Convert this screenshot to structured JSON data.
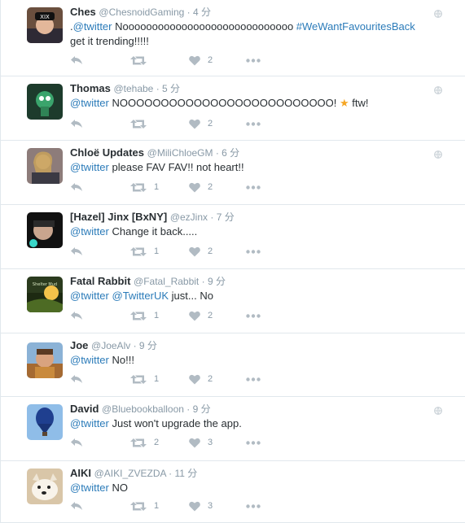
{
  "colors": {
    "link": "#2b7bb9",
    "meta": "#8899a6",
    "icon": "#b1bbc3",
    "divider": "#e1e8ed"
  },
  "tweets": [
    {
      "name": "Ches",
      "handle": "@ChesnoidGaming",
      "time": "4 分",
      "text": [
        {
          "t": "."
        },
        {
          "t": "@twitter",
          "k": "mention"
        },
        {
          "t": " Nooooooooooooooooooooooooooooo "
        },
        {
          "t": "#WeWantFavouritesBack",
          "k": "hashtag"
        },
        {
          "t": " get it trending!!!!!"
        }
      ],
      "retweets": "",
      "likes": "2",
      "globe": true
    },
    {
      "name": "Thomas",
      "handle": "@tehabe",
      "time": "5 分",
      "text": [
        {
          "t": "@twitter",
          "k": "mention"
        },
        {
          "t": " NOOOOOOOOOOOOOOOOOOOOOOOOOO! "
        },
        {
          "t": "★",
          "k": "star"
        },
        {
          "t": " ftw!"
        }
      ],
      "retweets": "",
      "likes": "2",
      "globe": true
    },
    {
      "name": "Chloë Updates",
      "handle": "@MiliChloeGM",
      "time": "6 分",
      "text": [
        {
          "t": "@twitter",
          "k": "mention"
        },
        {
          "t": " please FAV FAV!! not heart!!"
        }
      ],
      "retweets": "1",
      "likes": "2",
      "globe": true
    },
    {
      "name": "[Hazel] Jinx [BxNY]",
      "handle": "@ezJinx",
      "time": "7 分",
      "text": [
        {
          "t": "@twitter",
          "k": "mention"
        },
        {
          "t": " Change it back....."
        }
      ],
      "retweets": "1",
      "likes": "2",
      "globe": false
    },
    {
      "name": "Fatal Rabbit",
      "handle": "@Fatal_Rabbit",
      "time": "9 分",
      "text": [
        {
          "t": "@twitter",
          "k": "mention"
        },
        {
          "t": " "
        },
        {
          "t": "@TwitterUK",
          "k": "mention"
        },
        {
          "t": " just... No"
        }
      ],
      "retweets": "1",
      "likes": "2",
      "globe": false
    },
    {
      "name": "Joe",
      "handle": "@JoeAlv",
      "time": "9 分",
      "text": [
        {
          "t": "@twitter",
          "k": "mention"
        },
        {
          "t": " No!!!"
        }
      ],
      "retweets": "1",
      "likes": "2",
      "globe": false
    },
    {
      "name": "David",
      "handle": "@Bluebookballoon",
      "time": "9 分",
      "text": [
        {
          "t": "@twitter",
          "k": "mention"
        },
        {
          "t": " Just won't upgrade the app."
        }
      ],
      "retweets": "2",
      "likes": "3",
      "globe": true
    },
    {
      "name": "AIKI",
      "handle": "@AIKI_ZVEZDA",
      "time": "11 分",
      "text": [
        {
          "t": "@twitter",
          "k": "mention"
        },
        {
          "t": " NO"
        }
      ],
      "retweets": "1",
      "likes": "3",
      "globe": false
    }
  ]
}
